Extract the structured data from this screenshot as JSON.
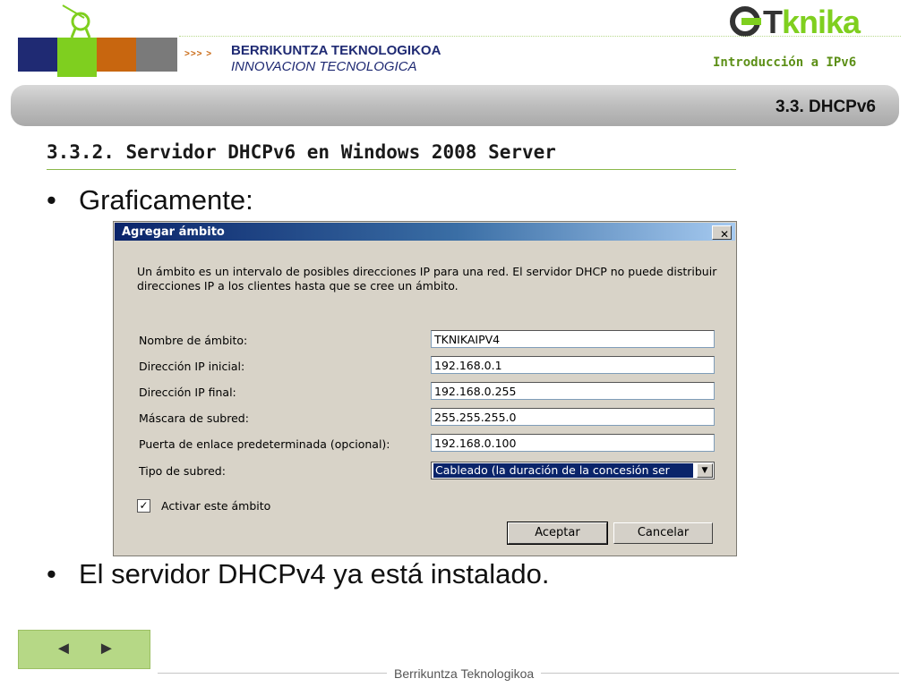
{
  "header": {
    "brand_line1": "BERRIKUNTZA TEKNOLOGIKOA",
    "brand_line2": "INNOVACION TECNOLOGICA",
    "arrows": ">>> >",
    "logo_prefix": "T",
    "logo_suffix": "knika",
    "topic": "Introducción a IPv6",
    "section_badge": "3.3. DHCPv6"
  },
  "slide": {
    "subtitle": "3.3.2. Servidor DHCPv6 en Windows 2008 Server",
    "bullets": [
      "Graficamente:",
      "El servidor DHCPv4 ya está instalado."
    ]
  },
  "dialog": {
    "title": "Agregar ámbito",
    "close_label": "✕",
    "description": "Un ámbito es un intervalo de posibles direcciones IP para una red. El servidor DHCP no puede distribuir direcciones IP a los clientes hasta que se cree un ámbito.",
    "fields": [
      {
        "label": "Nombre de ámbito:",
        "value": "TKNIKAIPV4"
      },
      {
        "label": "Dirección IP inicial:",
        "value": "192.168.0.1"
      },
      {
        "label": "Dirección IP final:",
        "value": "192.168.0.255"
      },
      {
        "label": "Máscara de subred:",
        "value": "255.255.255.0"
      },
      {
        "label": "Puerta de enlace predeterminada (opcional):",
        "value": "192.168.0.100"
      }
    ],
    "subnet_type": {
      "label": "Tipo de subred:",
      "value": "Cableado (la duración de la concesión ser"
    },
    "activate": {
      "label": "Activar este ámbito",
      "checked": true
    },
    "ok_label": "Aceptar",
    "cancel_label": "Cancelar"
  },
  "footer": {
    "prev": "◄",
    "next": "►",
    "label": "Berrikuntza Teknologikoa"
  },
  "colors": {
    "navy": "#1f2a73",
    "green": "#7fcf1f",
    "orange": "#c8660f",
    "gray": "#7a7a7a"
  }
}
